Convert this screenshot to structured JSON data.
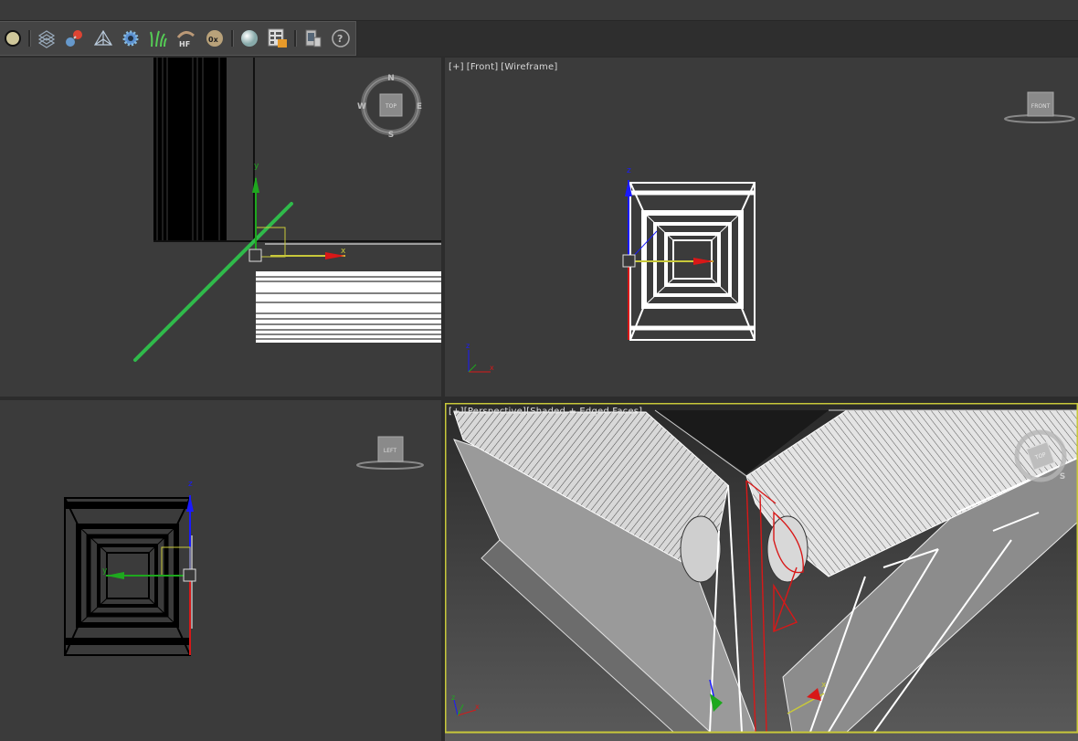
{
  "toolbar": {
    "buttons": [
      {
        "name": "sphere-icon",
        "label": ""
      },
      {
        "name": "grid-icon",
        "label": ""
      },
      {
        "name": "molecule-icon",
        "label": ""
      },
      {
        "name": "pyramid-icon",
        "label": ""
      },
      {
        "name": "gear-icon",
        "label": ""
      },
      {
        "name": "grass-icon",
        "label": ""
      },
      {
        "name": "hair-fur-icon",
        "label": "HF"
      },
      {
        "name": "zero-x-icon",
        "label": "0x"
      },
      {
        "name": "material-sphere-icon",
        "label": ""
      },
      {
        "name": "render-setup-icon",
        "label": ""
      },
      {
        "name": "device-icon",
        "label": ""
      },
      {
        "name": "help-icon",
        "label": "?"
      }
    ]
  },
  "viewports": {
    "top": {
      "label": "",
      "navcube": {
        "face": "TOP",
        "n": "N",
        "s": "S",
        "e": "E",
        "w": "W"
      },
      "gizmo": {
        "x": "x",
        "y": "y"
      }
    },
    "front": {
      "label_parts": [
        "[+]",
        "[Front]",
        "[Wireframe]"
      ],
      "navcube": {
        "face": "FRONT"
      },
      "axis": {
        "x": "x",
        "z": "z"
      }
    },
    "left": {
      "label": "",
      "navcube": {
        "face": "LEFT"
      },
      "gizmo": {
        "y": "y",
        "z": "z"
      }
    },
    "perspective": {
      "label": "[+][Perspective][Shaded + Edged Faces]",
      "navcube": {
        "face": "TOP",
        "s": "S"
      },
      "gizmo": {
        "x": "x",
        "z": "z"
      }
    }
  },
  "colors": {
    "viewport_bg": "#3b3b3b",
    "active_border": "#c8c83a",
    "axis_x": "#d81818",
    "axis_y": "#1ea81e",
    "axis_z": "#1a1aff"
  }
}
